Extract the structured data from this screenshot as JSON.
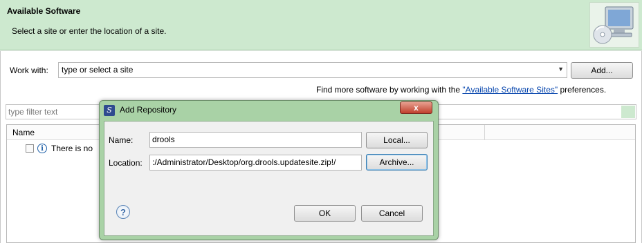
{
  "header": {
    "title": "Available Software",
    "description": "Select a site or enter the location of a site.",
    "image_icon": "software-monitor-cd-icon"
  },
  "work_with": {
    "label": "Work with:",
    "value": "type or select a site",
    "add_button": "Add..."
  },
  "find_more": {
    "prefix": "Find more software by working with the ",
    "link": "\"Available Software Sites\"",
    "suffix": " preferences."
  },
  "filter": {
    "placeholder": "type filter text"
  },
  "tree": {
    "columns": [
      "Name"
    ],
    "rows": [
      {
        "text": "There is no",
        "icon": "info-icon",
        "checked": false
      }
    ]
  },
  "dialog": {
    "title": "Add Repository",
    "close_label": "x",
    "name_label": "Name:",
    "name_value": "drools",
    "location_label": "Location:",
    "location_value": ":/Administrator/Desktop/org.drools.updatesite.zip!/",
    "local_button": "Local...",
    "archive_button": "Archive...",
    "ok_button": "OK",
    "cancel_button": "Cancel",
    "help_icon": "?"
  }
}
